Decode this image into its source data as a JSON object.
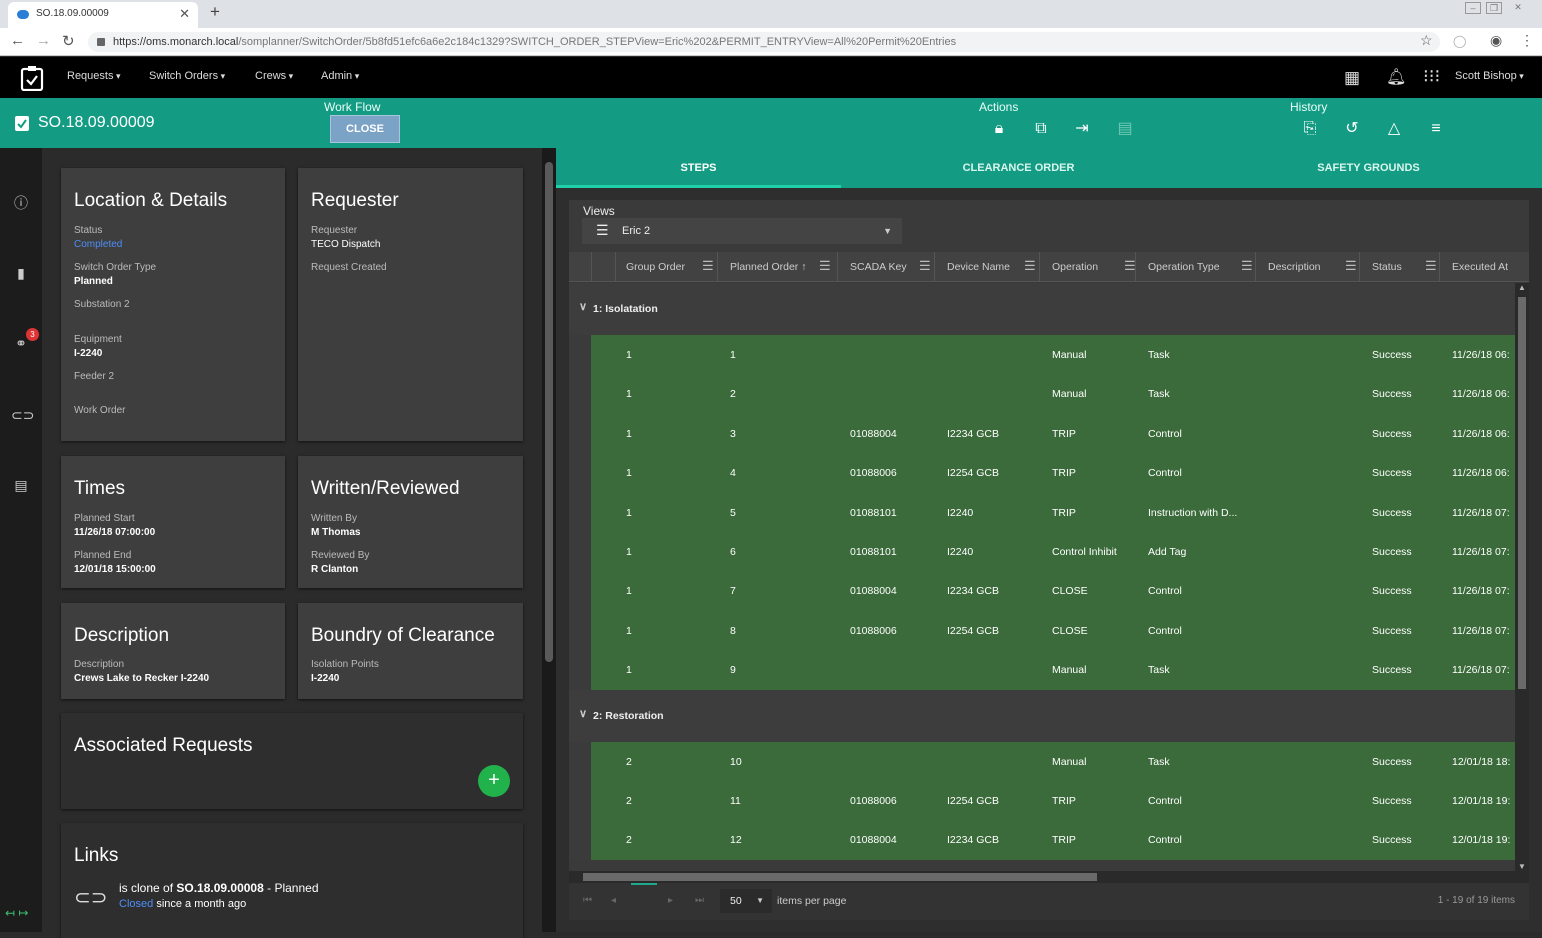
{
  "browser": {
    "tab_title": "SO.18.09.00009",
    "tab_close": "✕",
    "new_tab": "+",
    "url_host": "https://oms.monarch.local",
    "url_path": "/somplanner/SwitchOrder/5b8fd51efc6a6e2c184c1329?SWITCH_ORDER_STEPView=Eric%202&PERMIT_ENTRYView=All%20Permit%20Entries"
  },
  "nav": {
    "menus": [
      "Requests",
      "Switch Orders",
      "Crews",
      "Admin"
    ],
    "user": "Scott Bishop"
  },
  "header": {
    "order_id": "SO.18.09.00009",
    "workflow_label": "Work Flow",
    "close_button": "CLOSE",
    "actions_label": "Actions",
    "history_label": "History"
  },
  "sidebar": {
    "badge_count": "3",
    "collapse_icons": "↤ ↦"
  },
  "cards": {
    "location": {
      "title": "Location & Details",
      "status_label": "Status",
      "status_value": "Completed",
      "type_label": "Switch Order Type",
      "type_value": "Planned",
      "substation_label": "Substation 2",
      "equipment_label": "Equipment",
      "equipment_value": "I-2240",
      "feeder_label": "Feeder 2",
      "workorder_label": "Work Order"
    },
    "requester": {
      "title": "Requester",
      "requester_label": "Requester",
      "requester_value": "TECO Dispatch",
      "created_label": "Request Created"
    },
    "times": {
      "title": "Times",
      "start_label": "Planned Start",
      "start_value": "11/26/18 07:00:00",
      "end_label": "Planned End",
      "end_value": "12/01/18 15:00:00"
    },
    "written": {
      "title": "Written/Reviewed",
      "written_label": "Written By",
      "written_value": "M Thomas",
      "reviewed_label": "Reviewed By",
      "reviewed_value": "R Clanton"
    },
    "description": {
      "title": "Description",
      "desc_label": "Description",
      "desc_value": "Crews Lake to Recker I-2240"
    },
    "boundry": {
      "title": "Boundry of Clearance",
      "iso_label": "Isolation Points",
      "iso_value": "I-2240"
    },
    "associated": {
      "title": "Associated Requests",
      "add_symbol": "+"
    },
    "links": {
      "title": "Links",
      "line1_prefix": "is clone of",
      "line1_id": "SO.18.09.00008",
      "line1_suffix": "- Planned",
      "line2_status": "Closed",
      "line2_suffix": "since a month ago"
    }
  },
  "tabs": [
    "STEPS",
    "CLEARANCE ORDER",
    "SAFETY GROUNDS"
  ],
  "grid": {
    "views_label": "Views",
    "selected_view": "Eric 2",
    "columns": [
      "Group Order",
      "Planned Order ↑",
      "SCADA Key",
      "Device Name",
      "Operation",
      "Operation Type",
      "Description",
      "Status",
      "Executed At"
    ],
    "groups": [
      {
        "label": "1: Isolatation",
        "rows": [
          [
            "1",
            "1",
            "",
            "",
            "Manual",
            "Task",
            "",
            "Success",
            "11/26/18 06:"
          ],
          [
            "1",
            "2",
            "",
            "",
            "Manual",
            "Task",
            "",
            "Success",
            "11/26/18 06:"
          ],
          [
            "1",
            "3",
            "01088004",
            "I2234 GCB",
            "TRIP",
            "Control",
            "",
            "Success",
            "11/26/18 06:"
          ],
          [
            "1",
            "4",
            "01088006",
            "I2254 GCB",
            "TRIP",
            "Control",
            "",
            "Success",
            "11/26/18 06:"
          ],
          [
            "1",
            "5",
            "01088101",
            "I2240",
            "TRIP",
            "Instruction with D...",
            "",
            "Success",
            "11/26/18 07:"
          ],
          [
            "1",
            "6",
            "01088101",
            "I2240",
            "Control Inhibit",
            "Add Tag",
            "",
            "Success",
            "11/26/18 07:"
          ],
          [
            "1",
            "7",
            "01088004",
            "I2234 GCB",
            "CLOSE",
            "Control",
            "",
            "Success",
            "11/26/18 07:"
          ],
          [
            "1",
            "8",
            "01088006",
            "I2254 GCB",
            "CLOSE",
            "Control",
            "",
            "Success",
            "11/26/18 07:"
          ],
          [
            "1",
            "9",
            "",
            "",
            "Manual",
            "Task",
            "",
            "Success",
            "11/26/18 07:"
          ]
        ]
      },
      {
        "label": "2: Restoration",
        "rows": [
          [
            "2",
            "10",
            "",
            "",
            "Manual",
            "Task",
            "",
            "Success",
            "12/01/18 18:"
          ],
          [
            "2",
            "11",
            "01088006",
            "I2254 GCB",
            "TRIP",
            "Control",
            "",
            "Success",
            "12/01/18 19:"
          ],
          [
            "2",
            "12",
            "01088004",
            "I2234 GCB",
            "TRIP",
            "Control",
            "",
            "Success",
            "12/01/18 19:"
          ]
        ]
      }
    ],
    "page_size": "50",
    "items_per_page": "items per page",
    "range": "1 - 19 of 19 items"
  }
}
